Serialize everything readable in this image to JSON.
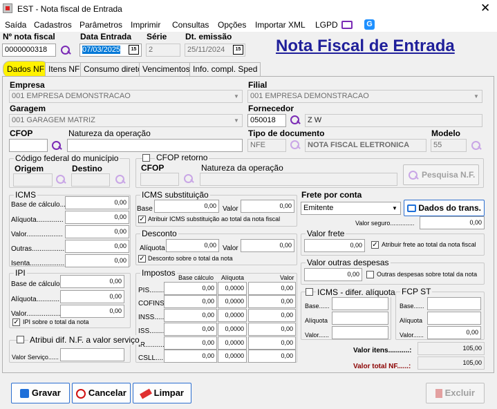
{
  "window": {
    "title": "EST - Nota fiscal de Entrada",
    "close": "✕"
  },
  "menu": [
    "Saída",
    "Cadastros",
    "Parâmetros",
    "Imprimir",
    "Consultas",
    "Opções",
    "Importar XML",
    "LGPD"
  ],
  "header": {
    "nota_label": "Nº nota fiscal",
    "nota_value": "0000000318",
    "data_entrada_label": "Data Entrada",
    "data_entrada_value": "07/03/2025",
    "serie_label": "Série",
    "serie_value": "2",
    "dt_emissao_label": "Dt. emissão",
    "dt_emissao_value": "25/11/2024",
    "cal_icon": "15",
    "big_title": "Nota Fiscal de Entrada"
  },
  "tabs": [
    "Dados NF",
    "Itens NF",
    "Consumo direto",
    "Vencimentos",
    "Info. compl. Sped"
  ],
  "form": {
    "empresa_label": "Empresa",
    "empresa_value": "001 EMPRESA DEMONSTRACAO",
    "filial_label": "Filial",
    "filial_value": "001 EMPRESA DEMONSTRACAO",
    "garagem_label": "Garagem",
    "garagem_value": "001 GARAGEM MATRIZ",
    "fornecedor_label": "Fornecedor",
    "fornecedor_code": "050018",
    "fornecedor_name": "Z W",
    "cfop_label": "CFOP",
    "natureza_label": "Natureza da operação",
    "tipo_doc_label": "Tipo de documento",
    "tipo_doc_code": "NFE",
    "tipo_doc_name": "NOTA FISCAL ELETRONICA",
    "modelo_label": "Modelo",
    "modelo_value": "55",
    "cod_municipio_label": "Código federal do município",
    "origem_label": "Origem",
    "destino_label": "Destino",
    "cfop_retorno_label": "CFOP retorno",
    "cfop2_label": "CFOP",
    "natureza2_label": "Natureza da operação",
    "pesquisa_nf": "Pesquisa N.F.",
    "frete_label": "Frete por conta",
    "frete_value": "Emitente",
    "dados_trans": "Dados do trans.",
    "valor_seguro_label": "Valor seguro..............",
    "valor_seguro_value": "0,00"
  },
  "icms": {
    "title": "ICMS",
    "rows": [
      {
        "label": "Base de cálculo...:",
        "value": "0,00"
      },
      {
        "label": "Alíquota..............",
        "value": "0,00"
      },
      {
        "label": "Valor...................",
        "value": "0,00"
      },
      {
        "label": "Outras.................",
        "value": "0,00"
      },
      {
        "label": "Isenta..................",
        "value": "0,00"
      }
    ]
  },
  "icms_st": {
    "title": "ICMS substituição",
    "base_label": "Base",
    "base_value": "0,00",
    "valor_label": "Valor",
    "valor_value": "0,00",
    "check_label": "Atribuir ICMS substituição ao total da nota fiscal"
  },
  "desconto": {
    "title": "Desconto",
    "aliquota_label": "Alíquota",
    "aliquota_value": "0,00",
    "valor_label": "Valor",
    "valor_value": "0,00",
    "check_label": "Desconto sobre o total da nota"
  },
  "ipi": {
    "title": "IPI",
    "rows": [
      {
        "label": "Base de cálculo..",
        "value": "0,00"
      },
      {
        "label": "Alíquota..............",
        "value": "0,00"
      },
      {
        "label": "Valor..................",
        "value": "0,00"
      }
    ],
    "check_label": "IPI sobre o total da nota"
  },
  "impostos": {
    "title": "Impostos",
    "col_base": "Base cálculo",
    "col_aliq": "Alíquota",
    "col_valor": "Valor",
    "rows": [
      {
        "label": "PIS........",
        "base": "0,00",
        "aliq": "0,0000",
        "valor": "0,00"
      },
      {
        "label": "COFINS...",
        "base": "0,00",
        "aliq": "0,0000",
        "valor": "0,00"
      },
      {
        "label": "INSS......",
        "base": "0,00",
        "aliq": "0,0000",
        "valor": "0,00"
      },
      {
        "label": "ISS........",
        "base": "0,00",
        "aliq": "0,0000",
        "valor": "0,00"
      },
      {
        "label": "IR..........",
        "base": "0,00",
        "aliq": "0,0000",
        "valor": "0,00"
      },
      {
        "label": "CSLL......",
        "base": "0,00",
        "aliq": "0,0000",
        "valor": "0,00"
      }
    ]
  },
  "atribui_dif": {
    "label": "Atribui dif. N.F. a valor serviço",
    "valor_servico_label": "Valor Serviço......"
  },
  "valor_frete": {
    "title": "Valor frete",
    "value": "0,00",
    "check_label": "Atribuir frete ao total da nota fiscal"
  },
  "outras_despesas": {
    "title": "Valor outras despesas",
    "value": "0,00",
    "check_label": "Outras despesas sobre total da nota"
  },
  "icms_dif": {
    "title": "ICMS - difer. alíquota",
    "rows": [
      {
        "label": "Base......",
        "value": ""
      },
      {
        "label": "Alíquota",
        "value": ""
      },
      {
        "label": "Valor......",
        "value": ""
      }
    ]
  },
  "fcp_st": {
    "title": "FCP ST",
    "rows": [
      {
        "label": "Base......",
        "value": ""
      },
      {
        "label": "Alíquota",
        "value": ""
      },
      {
        "label": "Valor......",
        "value": "0,00"
      }
    ]
  },
  "totais": {
    "valor_itens_label": "Valor itens...........:",
    "valor_itens_value": "105,00",
    "valor_total_label": "Valor total NF......:",
    "valor_total_value": "105,00"
  },
  "buttons": {
    "gravar": "Gravar",
    "cancelar": "Cancelar",
    "limpar": "Limpar",
    "excluir": "Excluir"
  }
}
